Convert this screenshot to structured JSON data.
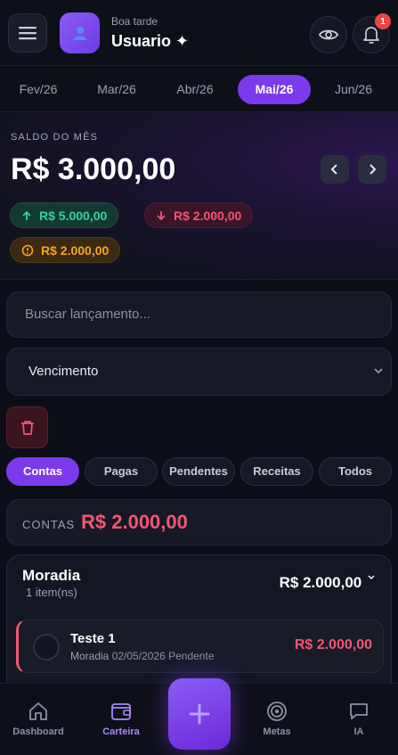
{
  "header": {
    "greeting": "Boa tarde",
    "username": "Usuario ✦",
    "notification_count": "1"
  },
  "months": [
    "Fev/26",
    "Mar/26",
    "Abr/26",
    "Mai/26",
    "Jun/26"
  ],
  "active_month": "Mai/26",
  "balance": {
    "label": "SALDO DO MÊS",
    "value": "R$ 3.000,00",
    "income": "R$ 5.000,00",
    "expense": "R$ 2.000,00",
    "pending": "R$ 2.000,00"
  },
  "search": {
    "placeholder": "Buscar lançamento..."
  },
  "sort": {
    "selected": "Vencimento"
  },
  "filters": [
    "Contas",
    "Pagas",
    "Pendentes",
    "Receitas",
    "Todos"
  ],
  "active_filter": "Contas",
  "summary": {
    "label": "CONTAS",
    "value": "R$ 2.000,00"
  },
  "group": {
    "title": "Moradia",
    "count": "1 item(ns)",
    "total": "R$ 2.000,00",
    "items": [
      {
        "title": "Teste 1",
        "category": "Moradia",
        "date": "02/05/2026",
        "status": "Pendente",
        "value": "R$ 2.000,00"
      }
    ]
  },
  "bottom_nav": {
    "dashboard": "Dashboard",
    "wallet": "Carteira",
    "goals": "Metas",
    "ai": "IA"
  },
  "colors": {
    "accent": "#7c3aed",
    "income": "#34d399",
    "expense": "#f25575",
    "pending": "#f5a524"
  }
}
